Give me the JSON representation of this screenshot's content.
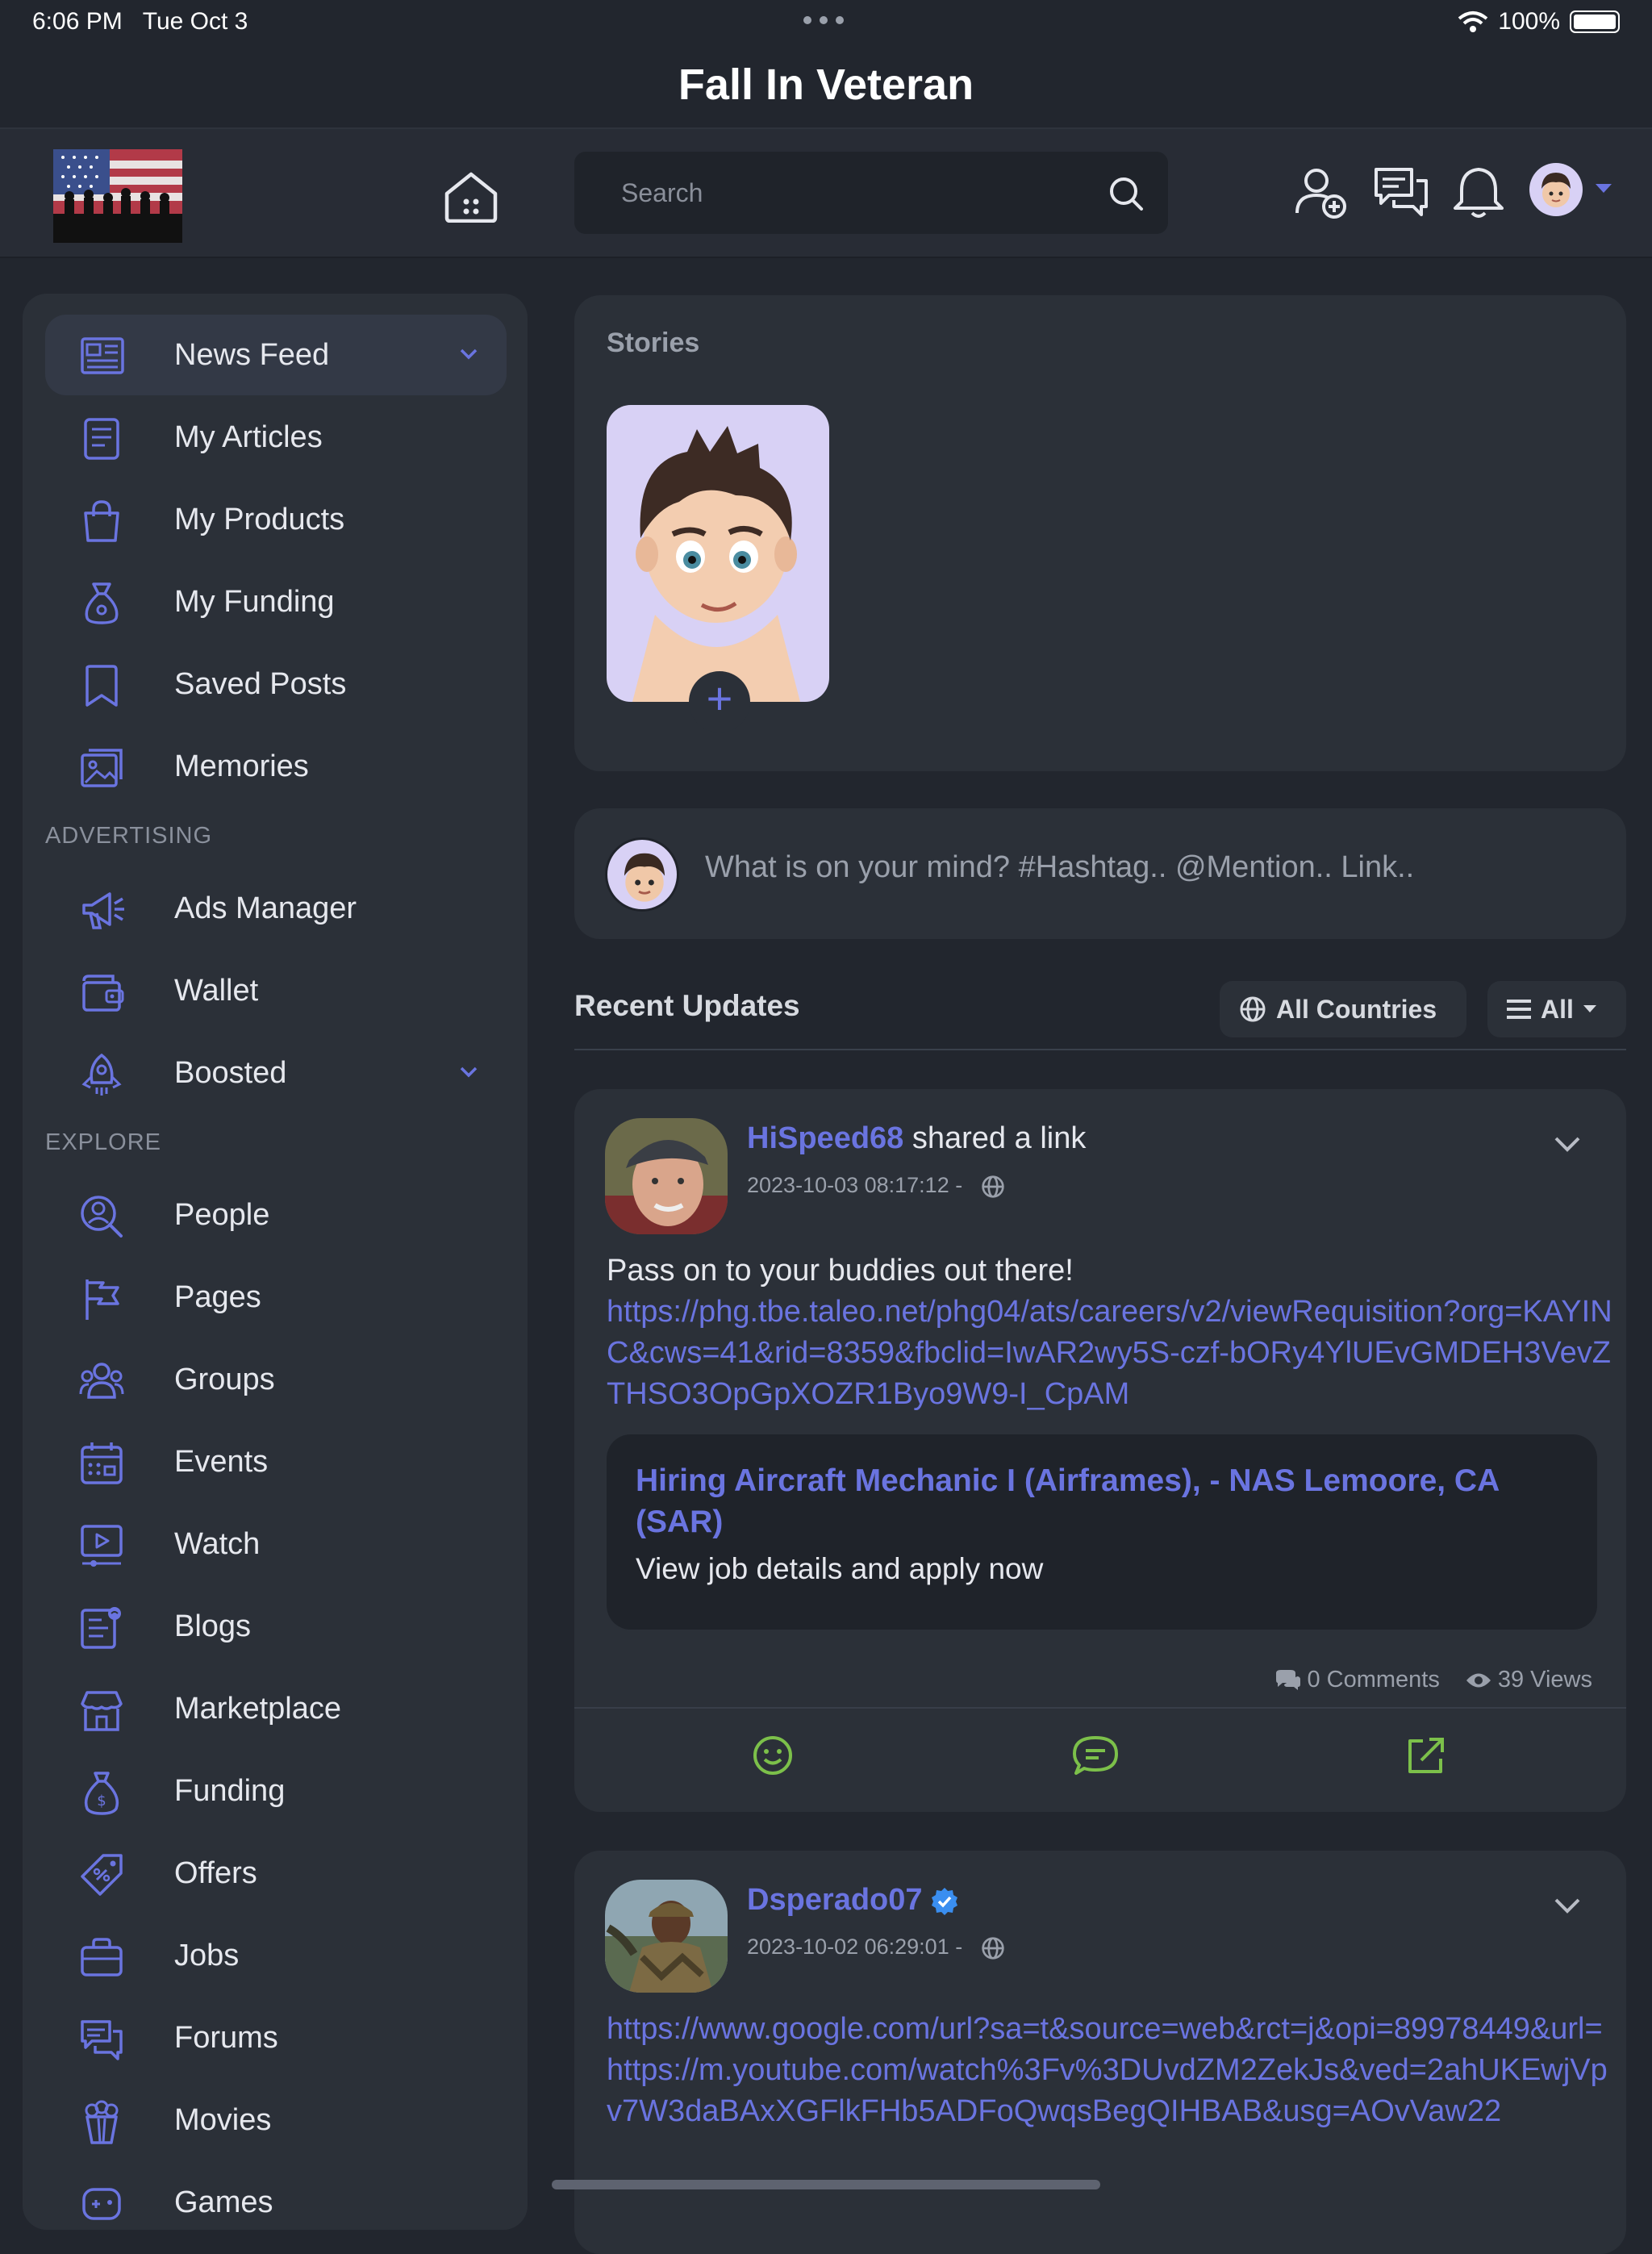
{
  "status_bar": {
    "time": "6:06 PM",
    "date": "Tue Oct 3",
    "battery": "100%"
  },
  "app_title": "Fall In Veteran",
  "header": {
    "search_placeholder": "Search"
  },
  "sidebar": {
    "items": [
      {
        "label": "News Feed",
        "icon": "newspaper-icon"
      },
      {
        "label": "My Articles",
        "icon": "article-icon"
      },
      {
        "label": "My Products",
        "icon": "shopping-bag-icon"
      },
      {
        "label": "My Funding",
        "icon": "money-bag-icon"
      },
      {
        "label": "Saved Posts",
        "icon": "bookmark-icon"
      },
      {
        "label": "Memories",
        "icon": "photos-icon"
      }
    ],
    "advertising_title": "ADVERTISING",
    "advertising": [
      {
        "label": "Ads Manager",
        "icon": "megaphone-icon"
      },
      {
        "label": "Wallet",
        "icon": "wallet-icon"
      },
      {
        "label": "Boosted",
        "icon": "rocket-icon"
      }
    ],
    "explore_title": "EXPLORE",
    "explore": [
      {
        "label": "People",
        "icon": "people-search-icon"
      },
      {
        "label": "Pages",
        "icon": "flag-icon"
      },
      {
        "label": "Groups",
        "icon": "groups-icon"
      },
      {
        "label": "Events",
        "icon": "calendar-icon"
      },
      {
        "label": "Watch",
        "icon": "video-icon"
      },
      {
        "label": "Blogs",
        "icon": "blog-icon"
      },
      {
        "label": "Marketplace",
        "icon": "store-icon"
      },
      {
        "label": "Funding",
        "icon": "funding-icon"
      },
      {
        "label": "Offers",
        "icon": "offer-tag-icon"
      },
      {
        "label": "Jobs",
        "icon": "briefcase-icon"
      },
      {
        "label": "Forums",
        "icon": "forum-icon"
      },
      {
        "label": "Movies",
        "icon": "popcorn-icon"
      },
      {
        "label": "Games",
        "icon": "gamepad-icon"
      }
    ]
  },
  "stories": {
    "title": "Stories"
  },
  "composer": {
    "placeholder": "What is on your mind? #Hashtag.. @Mention.. Link.."
  },
  "feed": {
    "title": "Recent Updates",
    "filter_countries": "All Countries",
    "filter_type": "All"
  },
  "posts": [
    {
      "user": "HiSpeed68",
      "action": "shared a link",
      "date": "2023-10-03 08:17:12 -",
      "text": "Pass on to your buddies out there!",
      "link": "https://phg.tbe.taleo.net/phg04/ats/careers/v2/viewRequisition?org=KAYINC&cws=41&rid=8359&fbclid=IwAR2wy5S-czf-bORy4YlUEvGMDEH3VevZTHSO3OpGpXOZR1Byo9W9-I_CpAM",
      "preview_title": "Hiring Aircraft Mechanic I (Airframes), - NAS Lemoore, CA (SAR)",
      "preview_desc": "View job details and apply now",
      "comments": "0 Comments",
      "views": "39 Views"
    },
    {
      "user": "Dsperado07",
      "date": "2023-10-02 06:29:01 -",
      "link": "https://www.google.com/url?sa=t&source=web&rct=j&opi=89978449&url=https://m.youtube.com/watch%3Fv%3DUvdZM2ZekJs&ved=2ahUKEwjVpv7W3daBAxXGFlkFHb5ADFoQwqsBegQIHBAB&usg=AOvVaw22"
    }
  ],
  "colors": {
    "accent": "#6a74e0",
    "action_green": "#7cc04a",
    "background": "#22262e",
    "card": "#2b3038"
  }
}
